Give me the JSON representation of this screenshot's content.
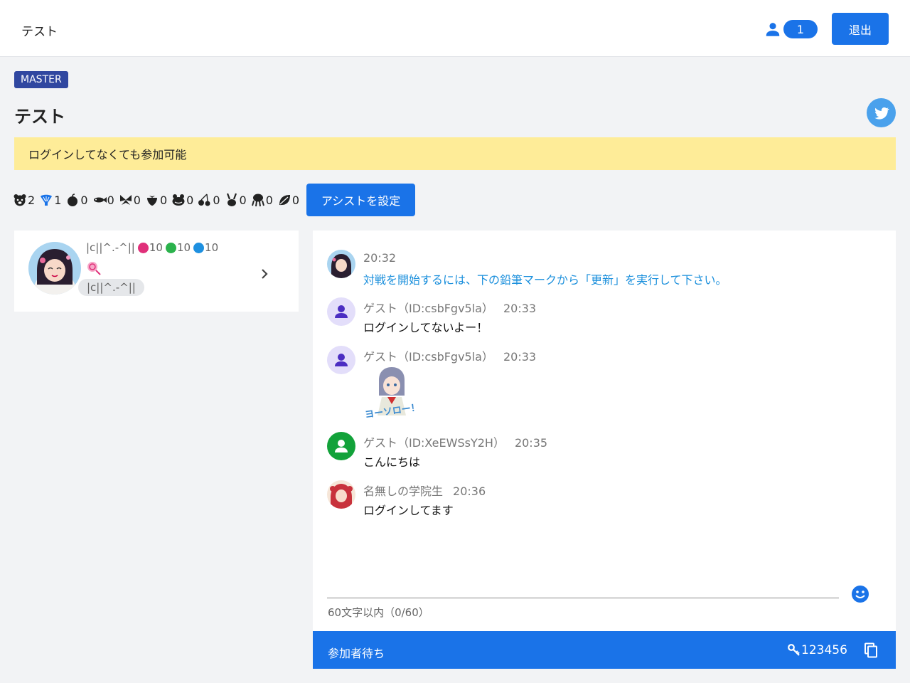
{
  "header": {
    "title": "テスト",
    "user_count": "1",
    "exit_label": "退出"
  },
  "room": {
    "badge": "MASTER",
    "title": "テスト",
    "notice": "ログインしてなくても参加可能"
  },
  "items": [
    {
      "icon": "bear-icon",
      "count": "2",
      "color": "#222222"
    },
    {
      "icon": "shell-icon",
      "count": "1",
      "color": "#1a73e8"
    },
    {
      "icon": "apple-icon",
      "count": "0",
      "color": "#222222"
    },
    {
      "icon": "fish-icon",
      "count": "0",
      "color": "#222222"
    },
    {
      "icon": "butterfly-icon",
      "count": "0",
      "color": "#222222"
    },
    {
      "icon": "strawberry-icon",
      "count": "0",
      "color": "#222222"
    },
    {
      "icon": "frog-icon",
      "count": "0",
      "color": "#222222"
    },
    {
      "icon": "cherry-icon",
      "count": "0",
      "color": "#222222"
    },
    {
      "icon": "rabbit-icon",
      "count": "0",
      "color": "#222222"
    },
    {
      "icon": "octopus-icon",
      "count": "0",
      "color": "#222222"
    },
    {
      "icon": "leaf-icon",
      "count": "0",
      "color": "#222222"
    }
  ],
  "assist_label": "アシストを設定",
  "player": {
    "name": "|c||^.-^||",
    "stats": [
      {
        "value": "10",
        "color": "#e0307a"
      },
      {
        "value": "10",
        "color": "#2bb24c"
      },
      {
        "value": "10",
        "color": "#1e90e0"
      }
    ],
    "tag": "|c||^.-^||"
  },
  "messages": [
    {
      "sender": "",
      "time": "20:32",
      "text": "対戦を開始するには、下の鉛筆マークから「更新」を実行して下さい。",
      "avatar": "character-avatar",
      "system": true
    },
    {
      "sender": "ゲスト（ID:csbFgv5la）",
      "time": "20:33",
      "text": "ログインしてないよー！",
      "avatar": "guest-avatar"
    },
    {
      "sender": "ゲスト（ID:csbFgv5la）",
      "time": "20:33",
      "text": "",
      "avatar": "guest-avatar",
      "sticker": true
    },
    {
      "sender": "ゲスト（ID:XeEWSsY2H）",
      "time": "20:35",
      "text": "こんにちは",
      "avatar": "guest-avatar-green"
    },
    {
      "sender": "名無しの学院生",
      "time": "20:36",
      "text": "ログインしてます",
      "avatar": "character-avatar-red"
    }
  ],
  "sticker_text": "ヨーソロー！",
  "chat_input": {
    "char_count": "60文字以内（0/60）"
  },
  "status": {
    "text": "参加者待ち",
    "room_key": "123456"
  },
  "colors": {
    "primary": "#1a73e8",
    "notice_bg": "#feec98",
    "badge": "#3047a0",
    "twitter": "#4aa1ec"
  }
}
